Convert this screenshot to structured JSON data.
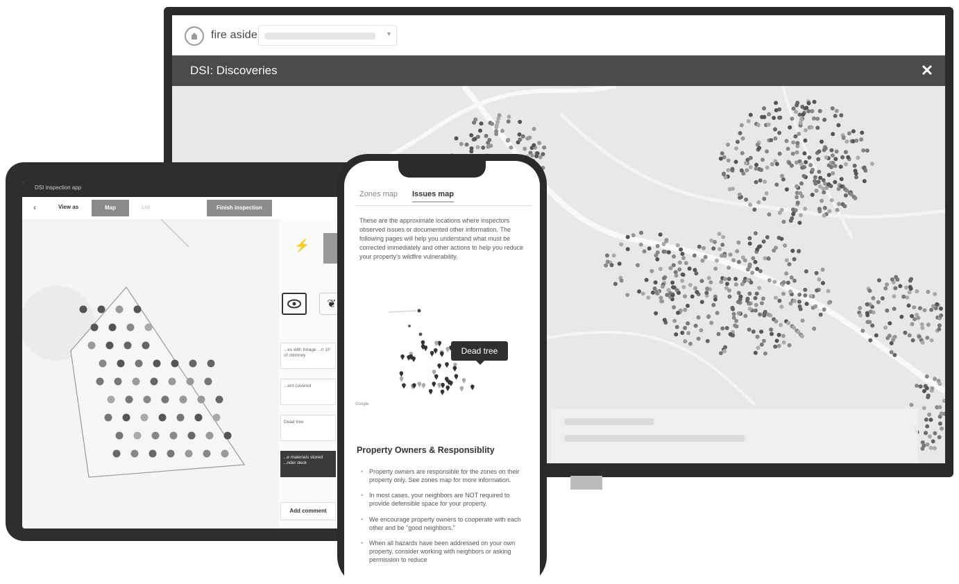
{
  "monitor": {
    "brand_name": "fire aside",
    "site_select": {
      "value": "",
      "caret": "▾"
    },
    "modal_title": "DSI: Discoveries",
    "close_glyph": "✕"
  },
  "tablet": {
    "status_text": "DSI inspection app",
    "back_glyph": "‹",
    "view_as_label": "View as",
    "map_tab_label": "Map",
    "list_tab_label": "List",
    "finish_button_label": "Finish inspection",
    "bolt_glyph": "⚡",
    "tree_glyph": "❦",
    "cards": [
      {
        "text": "...es with foliage ...n 10' of chimney"
      },
      {
        "text": "...ent covered"
      },
      {
        "text": "Dead tree"
      }
    ],
    "dark_card_text": "...e materials stored ...nder deck",
    "add_comment_label": "Add comment"
  },
  "phone": {
    "tabs": {
      "zones_label": "Zones map",
      "issues_label": "Issues map"
    },
    "intro_text": "These are the approximate locations where inspectors observed issues or documented other information. The following pages will help you understand what must be corrected immediately and other actions to help you reduce your property's wildfire vulnerability.",
    "tooltip_text": "Dead tree",
    "map_attribution": "Google",
    "heading": "Property Owners & Responsiblity",
    "bullets": [
      "Property owners are responsible for the zones on their property only. See zones map for more information.",
      "In most cases, your neighbors are NOT required to provide defensible space for your property.",
      "We encourage property owners to cooperate with each other and be \"good neighbors.\"",
      "When all hazards have been addressed on your own property, consider working with neighbors or asking permission to reduce"
    ]
  },
  "colors": {
    "modal_bar": "#4b4b4b",
    "device_frame": "#2a2a2a",
    "map_background": "#e8e8e8"
  }
}
